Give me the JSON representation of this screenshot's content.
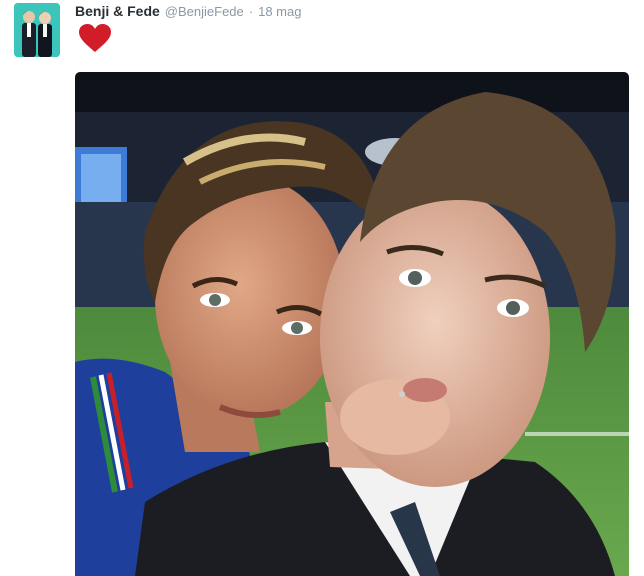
{
  "tweet": {
    "author_name": "Benji & Fede",
    "author_handle": "@BenjieFede",
    "separator": "·",
    "timestamp": "18 mag",
    "content_emoji": "heart-emoji",
    "media_type": "photo"
  },
  "colors": {
    "name": "#292f33",
    "meta": "#8899a6",
    "heart": "#d11c2a",
    "avatar_bg": "#3cc6bb"
  }
}
